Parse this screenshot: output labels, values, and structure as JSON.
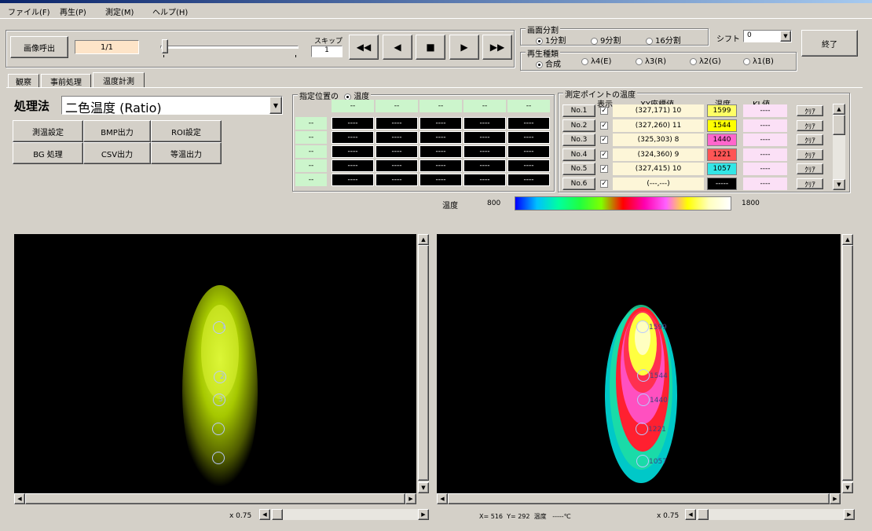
{
  "menu": [
    "ファイル(F)",
    "再生(P)",
    "測定(M)",
    "ヘルプ(H)"
  ],
  "toolbar": {
    "load_button": "画像呼出",
    "frame_counter": "1/1",
    "skip_label": "スキップ",
    "skip_value": "1",
    "exit_button": "終了",
    "transport": [
      "◀◀",
      "◀",
      "■",
      "▶",
      "▶▶"
    ]
  },
  "split": {
    "title": "画面分割",
    "options": [
      "1分割",
      "9分割",
      "16分割"
    ],
    "selected": 0,
    "shift_label": "シフト",
    "shift_value": "0"
  },
  "playback_type": {
    "title": "再生種類",
    "options": [
      "合成",
      "λ4(E)",
      "λ3(R)",
      "λ2(G)",
      "λ1(B)"
    ],
    "selected": 0
  },
  "tabs": [
    "観察",
    "事前処理",
    "温度計測"
  ],
  "active_tab": 2,
  "method": {
    "label": "処理法",
    "value": "二色温度 (Ratio)"
  },
  "action_buttons": [
    "測温設定",
    "BMP出力",
    "ROI設定",
    "BG 処理",
    "CSV出力",
    "等温出力"
  ],
  "position_grid": {
    "title": "指定位置の",
    "radio_label": "温度",
    "header": [
      "--",
      "--",
      "--",
      "--",
      "--"
    ],
    "rows": [
      {
        "label": "--",
        "values": [
          "----",
          "----",
          "----",
          "----",
          "----"
        ]
      },
      {
        "label": "--",
        "values": [
          "----",
          "----",
          "----",
          "----",
          "----"
        ]
      },
      {
        "label": "--",
        "values": [
          "----",
          "----",
          "----",
          "----",
          "----"
        ]
      },
      {
        "label": "--",
        "values": [
          "----",
          "----",
          "----",
          "----",
          "----"
        ]
      },
      {
        "label": "--",
        "values": [
          "----",
          "----",
          "----",
          "----",
          "----"
        ]
      }
    ]
  },
  "points": {
    "title": "測定ポイントの温度",
    "headers": [
      "表示",
      "XY座標値",
      "温度",
      "KL値"
    ],
    "rows": [
      {
        "name": "No.1",
        "checked": true,
        "xy": "(327,171) 10",
        "temp": "1599",
        "kl": "----",
        "clear": "ｸﾘｱ",
        "color": "#ffff66"
      },
      {
        "name": "No.2",
        "checked": true,
        "xy": "(327,260) 11",
        "temp": "1544",
        "kl": "----",
        "clear": "ｸﾘｱ",
        "color": "#ffff00"
      },
      {
        "name": "No.3",
        "checked": true,
        "xy": "(325,303) 8",
        "temp": "1440",
        "kl": "----",
        "clear": "ｸﾘｱ",
        "color": "#ff66cc"
      },
      {
        "name": "No.4",
        "checked": true,
        "xy": "(324,360) 9",
        "temp": "1221",
        "kl": "----",
        "clear": "ｸﾘｱ",
        "color": "#ff5555"
      },
      {
        "name": "No.5",
        "checked": true,
        "xy": "(327,415) 10",
        "temp": "1057",
        "kl": "----",
        "clear": "ｸﾘｱ",
        "color": "#33e6e6"
      },
      {
        "name": "No.6",
        "checked": true,
        "xy": "(---,---)",
        "temp": "-----",
        "kl": "----",
        "clear": "ｸﾘｱ",
        "color": "#000000"
      }
    ]
  },
  "colorbar": {
    "label": "温度",
    "min": "800",
    "max": "1800"
  },
  "left_view": {
    "zoom": "x 0.75",
    "point_labels": [
      "1",
      "2",
      "3"
    ]
  },
  "right_view": {
    "zoom": "x 0.75",
    "status": "X= 516  Y= 292  温度   -----℃",
    "point_labels": [
      "1599",
      "1544",
      "1440",
      "1221",
      "1057"
    ]
  }
}
